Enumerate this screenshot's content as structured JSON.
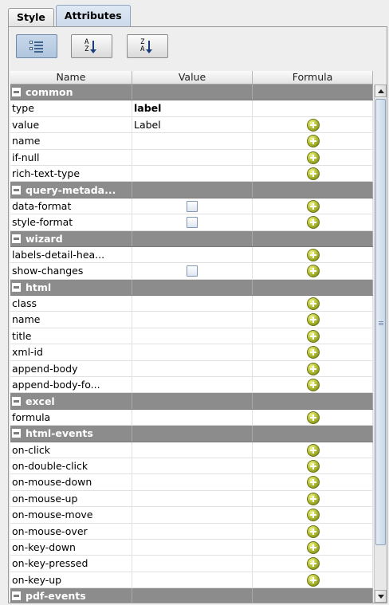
{
  "tabs": [
    {
      "label": "Style",
      "active": false
    },
    {
      "label": "Attributes",
      "active": true
    }
  ],
  "toolbar": {
    "buttons": [
      {
        "name": "categorized-view-button",
        "icon": "categorized-list-icon",
        "pressed": true
      },
      {
        "name": "sort-az-button",
        "icon": "sort-ascending-icon",
        "glyph_top": "A",
        "glyph_bottom": "Z",
        "pressed": false
      },
      {
        "name": "sort-za-button",
        "icon": "sort-descending-icon",
        "glyph_top": "Z",
        "glyph_bottom": "A",
        "pressed": false
      }
    ]
  },
  "table": {
    "columns": [
      "Name",
      "Value",
      "Formula"
    ],
    "rows": [
      {
        "kind": "group",
        "name": "common"
      },
      {
        "kind": "prop",
        "name": "type",
        "value": "label",
        "bold": true,
        "formula": false
      },
      {
        "kind": "prop",
        "name": "value",
        "value": "Label",
        "formula": true
      },
      {
        "kind": "prop",
        "name": "name",
        "value": "",
        "formula": true
      },
      {
        "kind": "prop",
        "name": "if-null",
        "value": "",
        "formula": true
      },
      {
        "kind": "prop",
        "name": "rich-text-type",
        "value": "",
        "formula": true
      },
      {
        "kind": "group",
        "name": "query-metada..."
      },
      {
        "kind": "prop",
        "name": "data-format",
        "checkbox": true,
        "formula": true
      },
      {
        "kind": "prop",
        "name": "style-format",
        "checkbox": true,
        "formula": true
      },
      {
        "kind": "group",
        "name": "wizard"
      },
      {
        "kind": "prop",
        "name": "labels-detail-hea...",
        "value": "",
        "formula": true
      },
      {
        "kind": "prop",
        "name": "show-changes",
        "checkbox": true,
        "formula": true
      },
      {
        "kind": "group",
        "name": "html"
      },
      {
        "kind": "prop",
        "name": "class",
        "value": "",
        "formula": true
      },
      {
        "kind": "prop",
        "name": "name",
        "value": "",
        "formula": true
      },
      {
        "kind": "prop",
        "name": "title",
        "value": "",
        "formula": true
      },
      {
        "kind": "prop",
        "name": "xml-id",
        "value": "",
        "formula": true
      },
      {
        "kind": "prop",
        "name": "append-body",
        "value": "",
        "formula": true
      },
      {
        "kind": "prop",
        "name": "append-body-fo...",
        "value": "",
        "formula": true
      },
      {
        "kind": "group",
        "name": "excel"
      },
      {
        "kind": "prop",
        "name": "formula",
        "value": "",
        "formula": true
      },
      {
        "kind": "group",
        "name": "html-events"
      },
      {
        "kind": "prop",
        "name": "on-click",
        "value": "",
        "formula": true
      },
      {
        "kind": "prop",
        "name": "on-double-click",
        "value": "",
        "formula": true
      },
      {
        "kind": "prop",
        "name": "on-mouse-down",
        "value": "",
        "formula": true
      },
      {
        "kind": "prop",
        "name": "on-mouse-up",
        "value": "",
        "formula": true
      },
      {
        "kind": "prop",
        "name": "on-mouse-move",
        "value": "",
        "formula": true
      },
      {
        "kind": "prop",
        "name": "on-mouse-over",
        "value": "",
        "formula": true
      },
      {
        "kind": "prop",
        "name": "on-key-down",
        "value": "",
        "formula": true
      },
      {
        "kind": "prop",
        "name": "on-key-pressed",
        "value": "",
        "formula": true
      },
      {
        "kind": "prop",
        "name": "on-key-up",
        "value": "",
        "formula": true
      },
      {
        "kind": "group",
        "name": "pdf-events"
      }
    ]
  },
  "colors": {
    "group_row": "#8c8c8c",
    "formula_icon": "#a8b52a",
    "active_tab": "#cbd9ea"
  }
}
